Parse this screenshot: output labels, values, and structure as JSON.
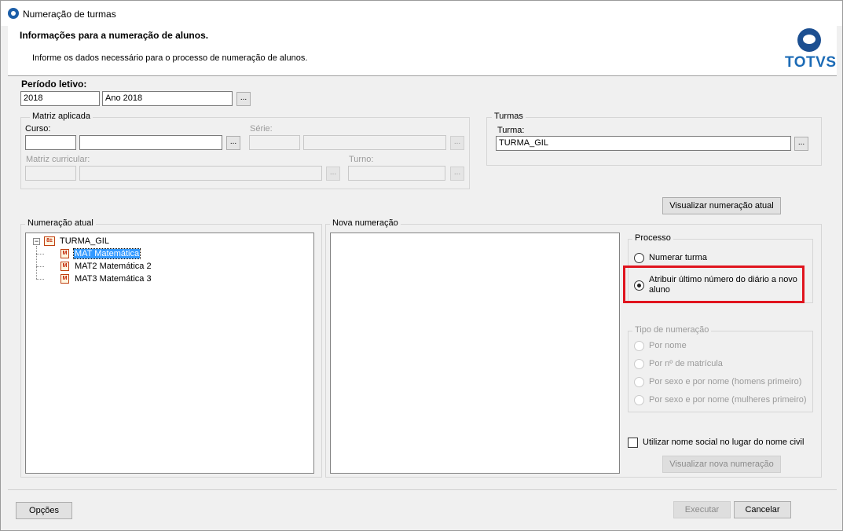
{
  "window": {
    "title": "Numeração de turmas"
  },
  "header": {
    "title": "Informações para a numeração de alunos.",
    "subtitle": "Informe os dados necessário para o processo de numeração de alunos.",
    "logo_text": "TOTVS"
  },
  "periodo": {
    "label": "Período letivo:",
    "code": "2018",
    "description": "Ano 2018",
    "lookup_label": "..."
  },
  "matriz": {
    "title": "Matriz aplicada",
    "curso_label": "Curso:",
    "curso_code": "",
    "curso_name": "",
    "serie_label": "Série:",
    "matriz_label": "Matriz curricular:",
    "turno_label": "Turno:",
    "lookup_label": "..."
  },
  "turmas": {
    "title": "Turmas",
    "turma_label": "Turma:",
    "turma_value": "TURMA_GIL",
    "lookup_label": "..."
  },
  "buttons": {
    "visualizar_atual": "Visualizar numeração atual",
    "visualizar_nova": "Visualizar nova numeração",
    "opcoes": "Opções",
    "executar": "Executar",
    "cancelar": "Cancelar"
  },
  "numeracao_atual": {
    "title": "Numeração atual",
    "tree": {
      "root": {
        "label": "TURMA_GIL",
        "icon": "class-icon",
        "expanded": true,
        "toggle": "−"
      },
      "children": [
        {
          "label": "MAT  Matemática",
          "icon": "subject-icon",
          "selected": true
        },
        {
          "label": "MAT2  Matemática 2",
          "icon": "subject-icon",
          "selected": false
        },
        {
          "label": "MAT3  Matemática 3",
          "icon": "subject-icon",
          "selected": false
        }
      ]
    }
  },
  "nova_numeracao": {
    "title": "Nova numeração"
  },
  "processo": {
    "title": "Processo",
    "options": [
      {
        "label": "Numerar turma",
        "selected": false
      },
      {
        "label": "Atribuir último número do diário a novo",
        "label2": "aluno",
        "selected": true
      }
    ]
  },
  "tipo_numeracao": {
    "title": "Tipo de numeração",
    "enabled": false,
    "options": [
      {
        "label": "Por nome"
      },
      {
        "label": "Por nº de matrícula"
      },
      {
        "label": "Por sexo e por nome (homens primeiro)"
      },
      {
        "label": "Por sexo e por nome (mulheres primeiro)"
      }
    ]
  },
  "nome_social": {
    "label": "Utilizar nome social no lugar do nome civil",
    "checked": false
  },
  "colors": {
    "highlight": "#e0141e",
    "selection": "#3399ff",
    "brand": "#1c6bb6"
  }
}
